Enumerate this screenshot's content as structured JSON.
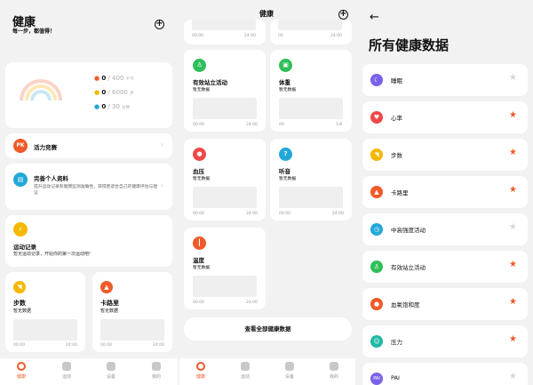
{
  "home": {
    "title": "健康",
    "subtitle": "每一步，都值得！",
    "stats": [
      {
        "current": "0",
        "goal": "/ 400",
        "unit": "千卡",
        "color": "#f05a28"
      },
      {
        "current": "0",
        "goal": "/ 6000",
        "unit": "步",
        "color": "#f5b800"
      },
      {
        "current": "0",
        "goal": "/ 30",
        "unit": "分钟",
        "color": "#22a8d8"
      }
    ],
    "vitality": {
      "badge": "PK",
      "label": "活力竞赛"
    },
    "profile": {
      "title": "完善个人资料",
      "desc": "提升运动记录和健康监测准确性，获得更适合自己的健康评估与建议"
    },
    "exercise": {
      "title": "运动记录",
      "desc": "暂无运动记录，开始你的第一次运动吧!"
    },
    "cards": [
      {
        "title": "步数",
        "status": "暂无数据",
        "t0": "00:00",
        "t1": "24:00"
      },
      {
        "title": "卡路里",
        "status": "暂无数据",
        "t0": "00:00",
        "t1": "24:00"
      }
    ]
  },
  "overview": {
    "title": "健康",
    "top_times": {
      "t0": "00:00",
      "t1": "24:00",
      "t2": "00",
      "t3": "24:00"
    },
    "cards": [
      {
        "title": "有效站立活动",
        "status": "暂无数据",
        "t0": "00:00",
        "t1": "24:00"
      },
      {
        "title": "体重",
        "status": "暂无数据",
        "t0": "00",
        "t1": "1/8"
      },
      {
        "title": "血压",
        "status": "暂无数据",
        "t0": "00:00",
        "t1": "24:00"
      },
      {
        "title": "听音",
        "status": "暂无数据",
        "t0": "00:00",
        "t1": "24:00"
      },
      {
        "title": "温度",
        "status": "暂无数据",
        "t0": "00:00",
        "t1": "24:00"
      }
    ],
    "view_all": "查看全部健康数据"
  },
  "nav": [
    "健康",
    "运动",
    "设备",
    "我的"
  ],
  "all_data": {
    "back": "←",
    "title": "所有健康数据",
    "items": [
      {
        "label": "睡眠",
        "color": "#7b61e8",
        "starred": false
      },
      {
        "label": "心率",
        "color": "#f04848",
        "starred": true
      },
      {
        "label": "步数",
        "color": "#f5b800",
        "starred": true
      },
      {
        "label": "卡路里",
        "color": "#f05a28",
        "starred": true
      },
      {
        "label": "中高强度活动",
        "color": "#22a8d8",
        "starred": false
      },
      {
        "label": "有效站立活动",
        "color": "#2fbf5a",
        "starred": true
      },
      {
        "label": "血氧饱和度",
        "color": "#f05a28",
        "starred": true
      },
      {
        "label": "压力",
        "color": "#1fb8a6",
        "starred": true
      },
      {
        "label": "PAI",
        "color": "#7b61e8",
        "starred": false
      }
    ]
  },
  "colors": {
    "accent": "#f05a28",
    "star_on": "#f05a28",
    "star_off": "#d6d6d6"
  }
}
